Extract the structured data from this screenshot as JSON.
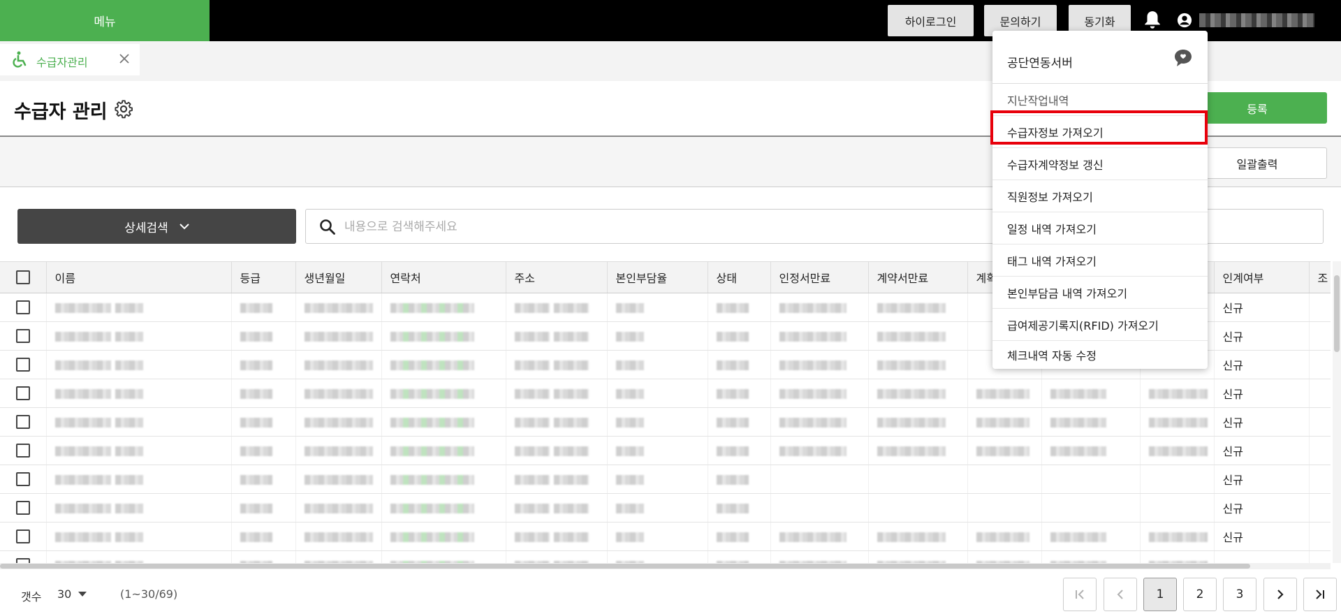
{
  "topbar": {
    "menu_label": "메뉴",
    "buttons": [
      "하이로그인",
      "문의하기",
      "동기화"
    ],
    "user_icon": "user-circle-icon",
    "bell_icon": "bell-icon"
  },
  "tab": {
    "label": "수급자관리",
    "icon": "wheelchair-icon",
    "close_icon": "close-icon"
  },
  "page": {
    "title": "수급자 관리",
    "register_label": "등록",
    "print_label": "일괄출력"
  },
  "search": {
    "advanced_label": "상세검색",
    "placeholder": "내용으로 검색해주세요"
  },
  "table": {
    "columns": [
      "이름",
      "등급",
      "생년월일",
      "연락처",
      "주소",
      "본인부담율",
      "상태",
      "인정서만료",
      "계약서만료",
      "계획",
      "",
      "",
      "인계여부",
      "조"
    ],
    "rows": [
      {
        "status": "신규"
      },
      {
        "status": "신규"
      },
      {
        "status": "신규"
      },
      {
        "status": "신규"
      },
      {
        "status": "신규"
      },
      {
        "status": "신규"
      },
      {
        "status": "신규"
      },
      {
        "status": "신규"
      },
      {
        "status": "신규"
      },
      {
        "status": ""
      }
    ]
  },
  "footer": {
    "count_label": "갯수",
    "count_value": "30",
    "range_text": "(1~30/69)",
    "pages": [
      "1",
      "2",
      "3"
    ],
    "current_page": "1"
  },
  "dropdown": {
    "title": "공단연동서버",
    "items": [
      "지난작업내역",
      "수급자정보 가져오기",
      "수급자계약정보 갱신",
      "직원정보 가져오기",
      "일정 내역 가져오기",
      "태그 내역 가져오기",
      "본인부담금 내역 가져오기",
      "급여제공기록지(RFID) 가져오기",
      "체크내역 자동 수정"
    ],
    "highlighted_item": "수급자정보 가져오기",
    "highlight_color": "#e8000b"
  },
  "colors": {
    "accent": "#4cb050",
    "topbar": "#000000"
  }
}
